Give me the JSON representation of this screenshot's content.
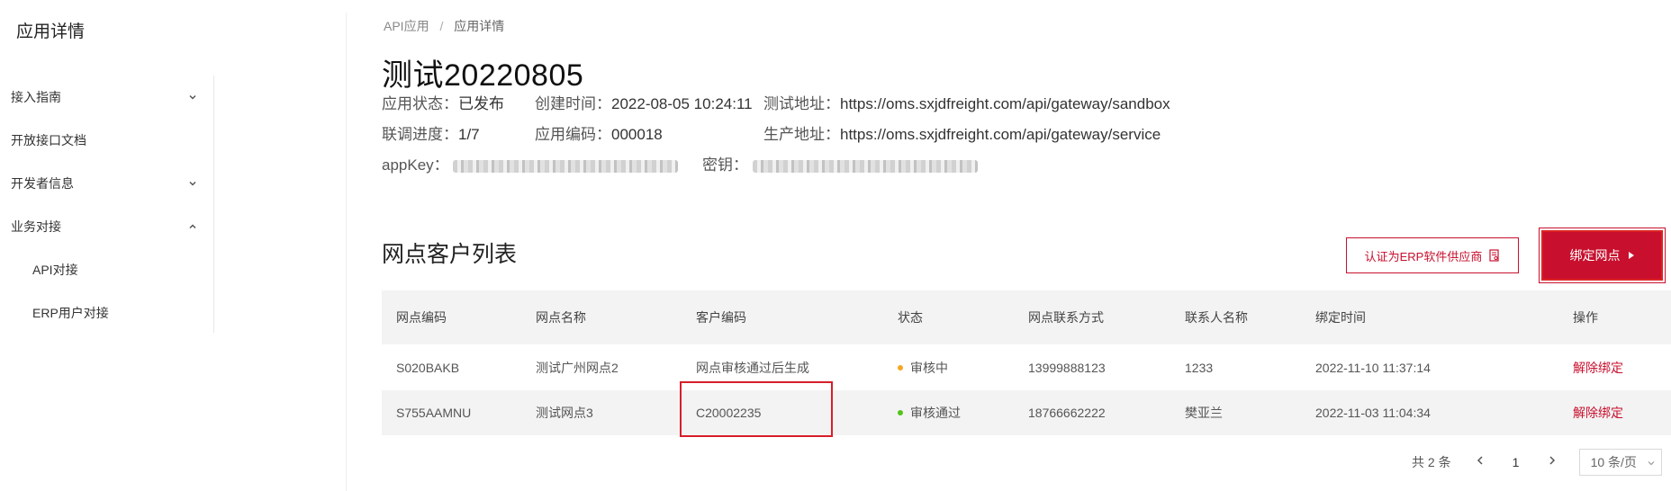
{
  "sidebar": {
    "title": "应用详情",
    "items": [
      {
        "label": "接入指南",
        "chevron": "down"
      },
      {
        "label": "开放接口文档"
      },
      {
        "label": "开发者信息",
        "chevron": "down"
      },
      {
        "label": "业务对接",
        "chevron": "up"
      },
      {
        "label": "API对接"
      },
      {
        "label": "ERP用户对接"
      }
    ]
  },
  "breadcrumb": {
    "parent": "API应用",
    "separator": "/",
    "current": "应用详情"
  },
  "app": {
    "title": "测试20220805",
    "status_label": "应用状态：",
    "status_value": "已发布",
    "created_label": "创建时间：",
    "created_value": "2022-08-05 10:24:11",
    "test_url_label": "测试地址：",
    "test_url_value": "https://oms.sxjdfreight.com/api/gateway/sandbox",
    "progress_label": "联调进度：",
    "progress_value": "1/7",
    "code_label": "应用编码：",
    "code_value": "000018",
    "prod_url_label": "生产地址：",
    "prod_url_value": "https://oms.sxjdfreight.com/api/gateway/service",
    "appkey_label": "appKey：",
    "secret_label": "密钥："
  },
  "section": {
    "title": "网点客户列表",
    "verify_button": "认证为ERP软件供应商",
    "bind_button": "绑定网点"
  },
  "table": {
    "headers": [
      "网点编码",
      "网点名称",
      "客户编码",
      "状态",
      "网点联系方式",
      "联系人名称",
      "绑定时间",
      "操作"
    ],
    "rows": [
      {
        "code": "S020BAKB",
        "name": "测试广州网点2",
        "customer_code": "网点审核通过后生成",
        "status": "审核中",
        "status_color": "#f5a623",
        "phone": "13999888123",
        "contact": "1233",
        "bind_time": "2022-11-10 11:37:14",
        "action": "解除绑定"
      },
      {
        "code": "S755AAMNU",
        "name": "测试网点3",
        "customer_code": "C20002235",
        "status": "审核通过",
        "status_color": "#52c41a",
        "phone": "18766662222",
        "contact": "樊亚兰",
        "bind_time": "2022-11-03 11:04:34",
        "action": "解除绑定"
      }
    ]
  },
  "pagination": {
    "total": "共 2 条",
    "current_page": "1",
    "page_size": "10 条/页"
  },
  "colors": {
    "accent": "#c8102e"
  }
}
